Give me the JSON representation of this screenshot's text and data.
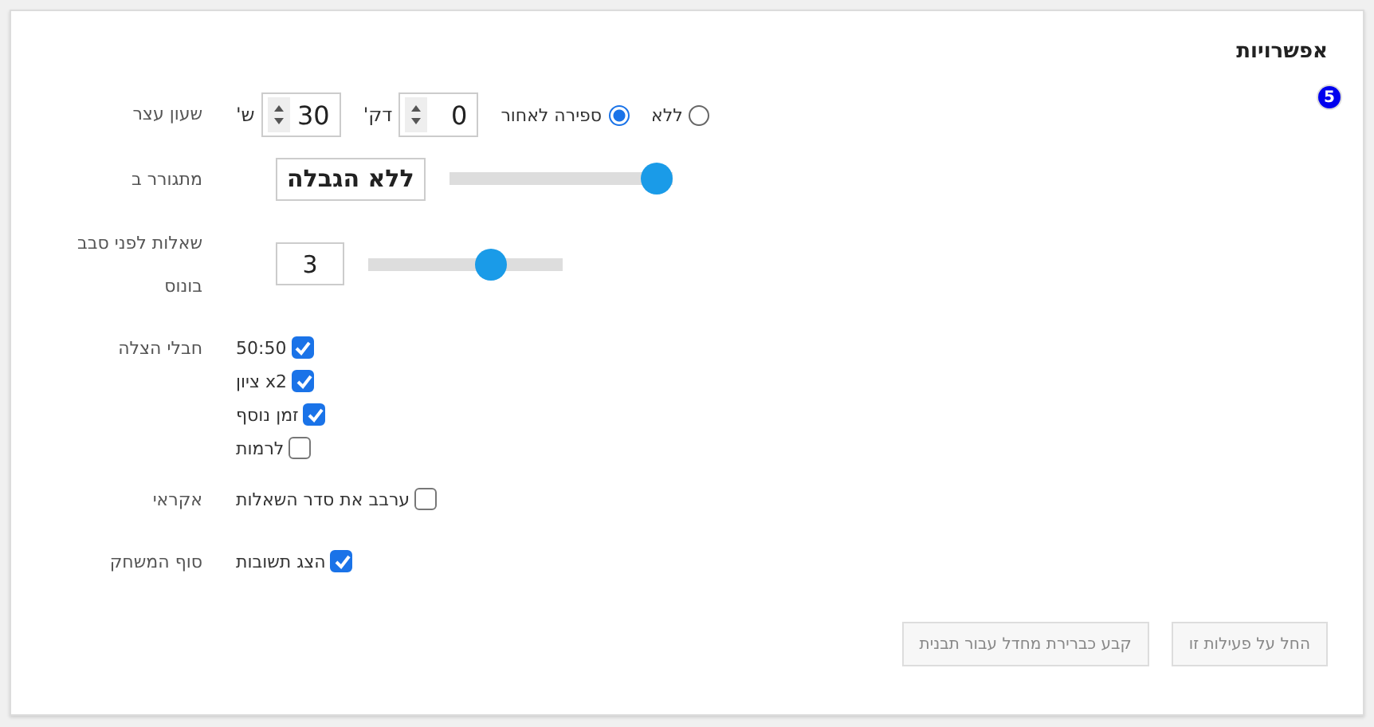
{
  "title": "אפשרויות",
  "badge": "5",
  "rows": [
    {
      "kind": "timer",
      "label": "שעון עצר",
      "options": [
        {
          "label": "ללא",
          "selected": false
        },
        {
          "label": "ספירה לאחור",
          "selected": true
        }
      ],
      "fields": [
        {
          "unit": "דק'",
          "value": "0"
        },
        {
          "unit": "ש'",
          "value": "30"
        }
      ]
    },
    {
      "kind": "slider",
      "label": "מתגורר ב",
      "value": "ללא הגבלה",
      "emphasis": true,
      "level": 1
    },
    {
      "kind": "slider",
      "label": "שאלות לפני סבב בונוס",
      "value": "3",
      "emphasis": false,
      "level": 0.66
    },
    {
      "kind": "checks",
      "label": "חבלי הצלה",
      "items": [
        {
          "label": "50:50",
          "checked": true
        },
        {
          "label": "x2 ציון",
          "checked": true
        },
        {
          "label": "זמן נוסף",
          "checked": true
        },
        {
          "label": "לרמות",
          "checked": false
        }
      ]
    },
    {
      "kind": "checks",
      "label": "אקראי",
      "items": [
        {
          "label": "ערבב את סדר השאלות",
          "checked": false
        }
      ]
    },
    {
      "kind": "checks",
      "label": "סוף המשחק",
      "items": [
        {
          "label": "הצג תשובות",
          "checked": true
        }
      ]
    }
  ],
  "buttons": [
    {
      "label": "החל על פעילות זו",
      "disabled": true
    },
    {
      "label": "קבע כברירת מחדל עבור תבנית",
      "disabled": true
    }
  ]
}
